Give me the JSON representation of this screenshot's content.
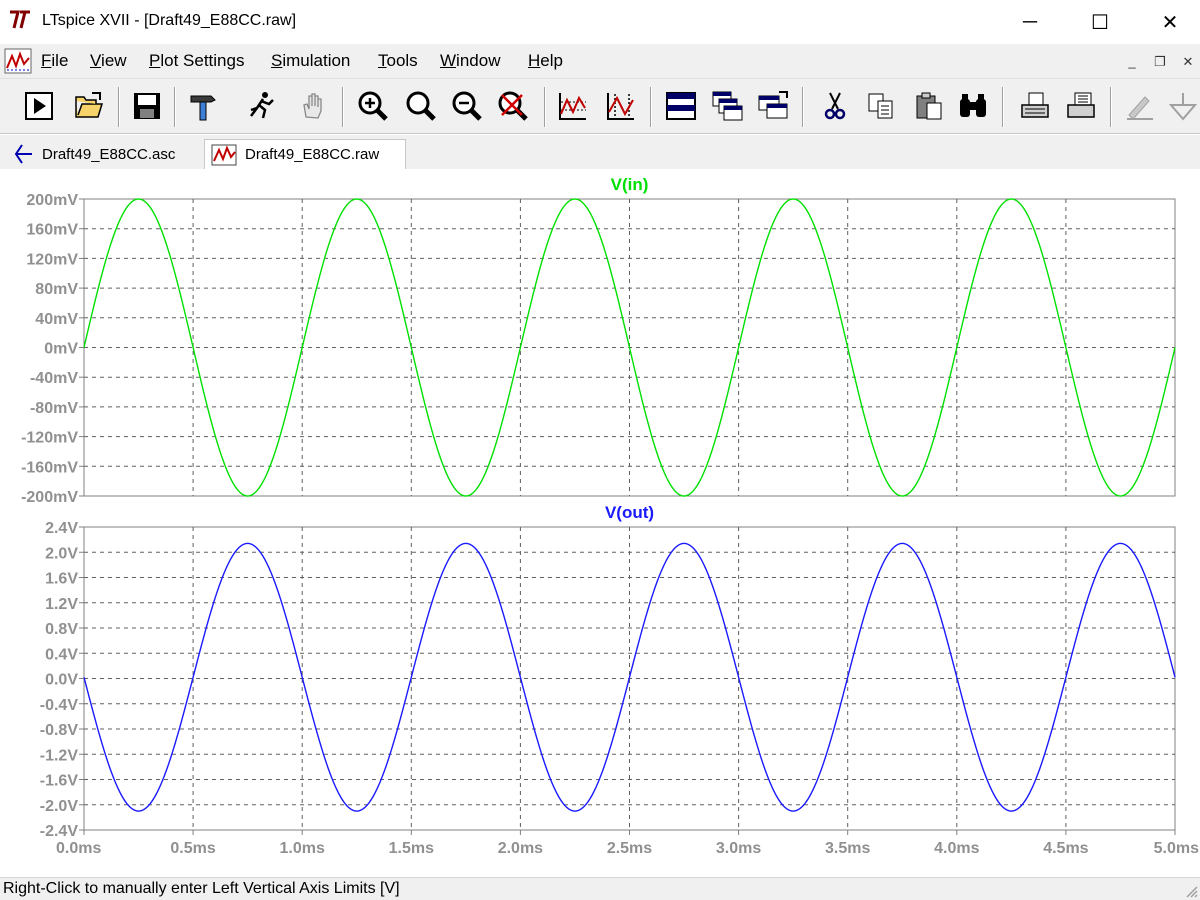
{
  "window": {
    "title": "LTspice XVII - [Draft49_E88CC.raw]",
    "controls": {
      "minimize": "─",
      "maximize": "☐",
      "close": "✕"
    }
  },
  "menubar": {
    "items": [
      "File",
      "View",
      "Plot Settings",
      "Simulation",
      "Tools",
      "Window",
      "Help"
    ],
    "mdi": {
      "minimize": "_",
      "restore": "❐",
      "close": "✕"
    }
  },
  "toolbar": {
    "buttons": [
      "run-icon",
      "open-folder-icon",
      "save-icon",
      "hammer-icon",
      "run-probe-icon",
      "pan-hand-icon",
      "zoom-in-icon",
      "zoom-area-icon",
      "zoom-out-icon",
      "zoom-cancel-icon",
      "autorange-icon",
      "cursor-measure-icon",
      "tile-horizontal-icon",
      "cascade-icon",
      "tile-vertical-icon",
      "cut-icon",
      "copy-icon",
      "paste-icon",
      "find-icon",
      "print-preview-icon",
      "print-icon",
      "pencil-icon",
      "ground-icon"
    ]
  },
  "tabs": [
    {
      "label": "Draft49_E88CC.asc",
      "icon": "schematic-icon",
      "active": false
    },
    {
      "label": "Draft49_E88CC.raw",
      "icon": "waveform-icon",
      "active": true
    }
  ],
  "status": {
    "text": "Right-Click to manually enter Left Vertical Axis Limits [V]"
  },
  "colors": {
    "vin": "#00e000",
    "vout": "#1a1aff",
    "grid": "#606060",
    "axis_text": "#909090"
  },
  "chart_data": [
    {
      "type": "line",
      "title": "V(in)",
      "xlim": [
        0,
        5.0
      ],
      "ylim": [
        -200,
        200
      ],
      "yticks": [
        "200mV",
        "160mV",
        "120mV",
        "80mV",
        "40mV",
        "0mV",
        "-40mV",
        "-80mV",
        "-120mV",
        "-160mV",
        "-200mV"
      ],
      "series": [
        {
          "name": "V(in)",
          "waveform": "sine",
          "amplitude": 200,
          "offset": 0,
          "period_ms": 1.0,
          "phase_deg": 0,
          "unit": "mV"
        }
      ]
    },
    {
      "type": "line",
      "title": "V(out)",
      "xlim": [
        0,
        5.0
      ],
      "ylim": [
        -2.4,
        2.4
      ],
      "yticks": [
        "2.4V",
        "2.0V",
        "1.6V",
        "1.2V",
        "0.8V",
        "0.4V",
        "0.0V",
        "-0.4V",
        "-0.8V",
        "-1.2V",
        "-1.6V",
        "-2.0V",
        "-2.4V"
      ],
      "xticks": [
        "0.0ms",
        "0.5ms",
        "1.0ms",
        "1.5ms",
        "2.0ms",
        "2.5ms",
        "3.0ms",
        "3.5ms",
        "4.0ms",
        "4.5ms",
        "5.0ms"
      ],
      "series": [
        {
          "name": "V(out)",
          "waveform": "sine",
          "amplitude": 2.12,
          "offset": 0.02,
          "period_ms": 1.0,
          "phase_deg": 180,
          "unit": "V"
        }
      ]
    }
  ]
}
